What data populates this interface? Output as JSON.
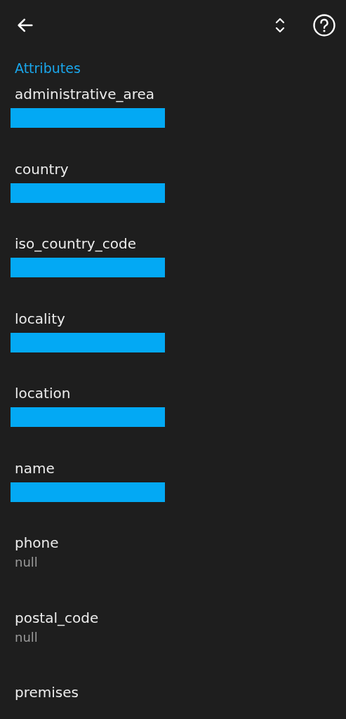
{
  "section_title": "Attributes",
  "attributes": [
    {
      "name": "administrative_area",
      "kind": "redacted"
    },
    {
      "name": "country",
      "kind": "redacted"
    },
    {
      "name": "iso_country_code",
      "kind": "redacted"
    },
    {
      "name": "locality",
      "kind": "redacted"
    },
    {
      "name": "location",
      "kind": "redacted"
    },
    {
      "name": "name",
      "kind": "redacted"
    },
    {
      "name": "phone",
      "kind": "text",
      "value": "null"
    },
    {
      "name": "postal_code",
      "kind": "text",
      "value": "null"
    },
    {
      "name": "premises",
      "kind": "label_only"
    }
  ]
}
